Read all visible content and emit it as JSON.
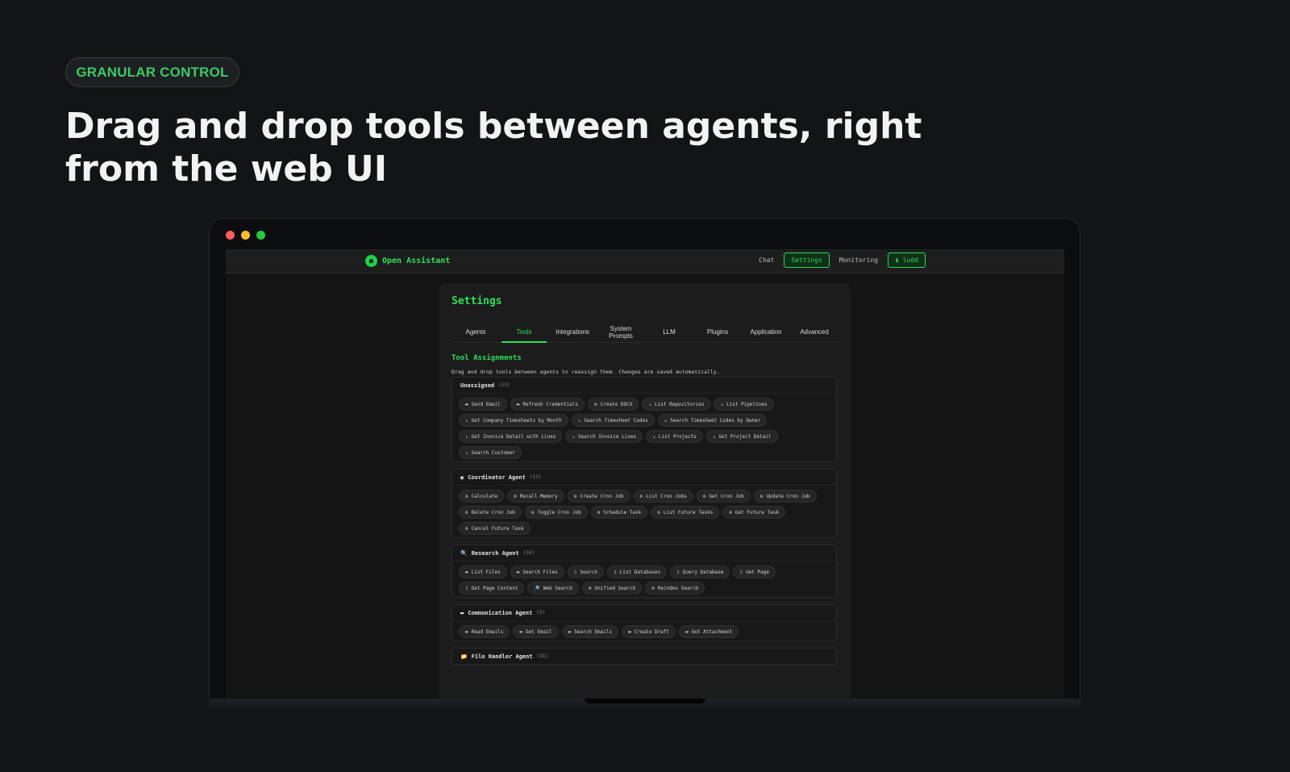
{
  "badge": "GRANULAR CONTROL",
  "headline": "Drag and drop tools between agents, right from the web UI",
  "app": {
    "brand": "Open Assistant",
    "brand_icon": "●",
    "nav": {
      "chat": "Chat",
      "settings": "Settings",
      "monitoring": "Monitoring",
      "user_button": "▮ ludd"
    }
  },
  "settings": {
    "title": "Settings",
    "tabs": [
      "Agents",
      "Tools",
      "Integrations",
      "System Prompts",
      "LLM",
      "Plugins",
      "Application",
      "Advanced"
    ],
    "active_tab": "Tools",
    "section_title": "Tool Assignments",
    "section_desc": "Drag and drop tools between agents to reassign them. Changes are saved automatically.",
    "groups": [
      {
        "icon": "",
        "name": "Unassigned",
        "count": "(13)",
        "tools": [
          {
            "icon": "▬",
            "label": "Send Email"
          },
          {
            "icon": "▬",
            "label": "Refresh Credentials"
          },
          {
            "icon": "⚙",
            "label": "Create DOCX"
          },
          {
            "icon": "↘",
            "label": "List Repositories"
          },
          {
            "icon": "↘",
            "label": "List Pipelines"
          },
          {
            "icon": "↘",
            "label": "Get Company Timesheets by Month"
          },
          {
            "icon": "↘",
            "label": "Search Timesheet Codes"
          },
          {
            "icon": "↘",
            "label": "Search Timesheet Codes by Owner"
          },
          {
            "icon": "↘",
            "label": "Get Invoice Detail with Lines"
          },
          {
            "icon": "↘",
            "label": "Search Invoice Lines"
          },
          {
            "icon": "↘",
            "label": "List Projects"
          },
          {
            "icon": "↘",
            "label": "Get Project Detail"
          },
          {
            "icon": "↘",
            "label": "Search Customer"
          }
        ]
      },
      {
        "icon": "◉",
        "name": "Coordinator Agent",
        "count": "(12)",
        "tools": [
          {
            "icon": "⚙",
            "label": "Calculate"
          },
          {
            "icon": "⚙",
            "label": "Recall Memory"
          },
          {
            "icon": "⚙",
            "label": "Create Cron Job"
          },
          {
            "icon": "⚙",
            "label": "List Cron Jobs"
          },
          {
            "icon": "⚙",
            "label": "Get Cron Job"
          },
          {
            "icon": "⚙",
            "label": "Update Cron Job"
          },
          {
            "icon": "⚙",
            "label": "Delete Cron Job"
          },
          {
            "icon": "⚙",
            "label": "Toggle Cron Job"
          },
          {
            "icon": "⚙",
            "label": "Schedule Task"
          },
          {
            "icon": "⚙",
            "label": "List Future Tasks"
          },
          {
            "icon": "⚙",
            "label": "Get Future Task"
          },
          {
            "icon": "⚙",
            "label": "Cancel Future Task"
          }
        ]
      },
      {
        "icon": "🔍",
        "name": "Research Agent",
        "count": "(10)",
        "tools": [
          {
            "icon": "▬",
            "label": "List Files"
          },
          {
            "icon": "▬",
            "label": "Search Files"
          },
          {
            "icon": "▯",
            "label": "Search"
          },
          {
            "icon": "▯",
            "label": "List Databases"
          },
          {
            "icon": "▯",
            "label": "Query Database"
          },
          {
            "icon": "▯",
            "label": "Get Page"
          },
          {
            "icon": "▯",
            "label": "Get Page Content"
          },
          {
            "icon": "🔎",
            "label": "Web Search"
          },
          {
            "icon": "⚙",
            "label": "Unified Search"
          },
          {
            "icon": "⚙",
            "label": "Reindex Search"
          }
        ]
      },
      {
        "icon": "▬",
        "name": "Communication Agent",
        "count": "(5)",
        "tools": [
          {
            "icon": "▬",
            "label": "Read Emails"
          },
          {
            "icon": "▬",
            "label": "Get Email"
          },
          {
            "icon": "▬",
            "label": "Search Emails"
          },
          {
            "icon": "▬",
            "label": "Create Draft"
          },
          {
            "icon": "▬",
            "label": "Get Attachment"
          }
        ]
      },
      {
        "icon": "📁",
        "name": "File Handler Agent",
        "count": "(21)",
        "tools": []
      }
    ]
  }
}
